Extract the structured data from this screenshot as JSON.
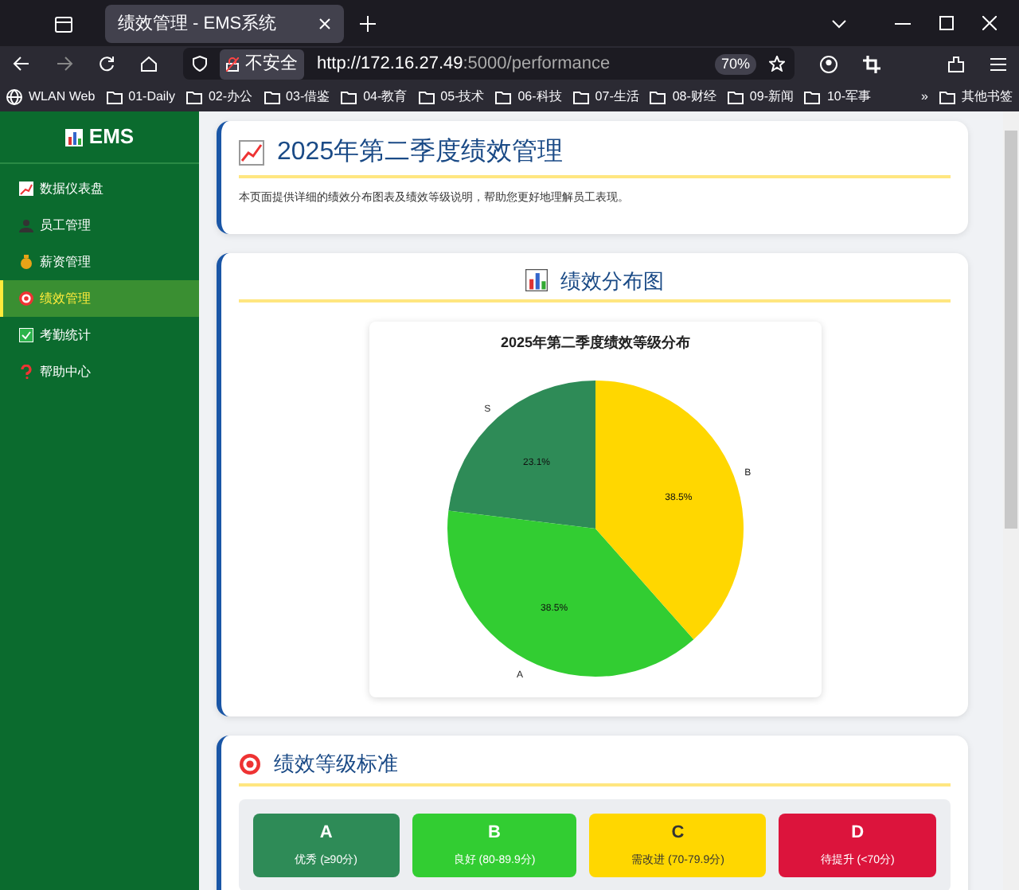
{
  "browser": {
    "tab_title": "绩效管理 - EMS系统",
    "security": "不安全",
    "url_host": "http://172.16.27.49",
    "url_rest": ":5000/performance",
    "zoom": "70%",
    "bookmarks": [
      {
        "label": "WLAN Web",
        "kind": "globe"
      },
      {
        "label": "01-Daily",
        "kind": "folder"
      },
      {
        "label": "02-办公",
        "kind": "folder"
      },
      {
        "label": "03-借鉴",
        "kind": "folder"
      },
      {
        "label": "04-教育",
        "kind": "folder"
      },
      {
        "label": "05-技术",
        "kind": "folder"
      },
      {
        "label": "06-科技",
        "kind": "folder"
      },
      {
        "label": "07-生活",
        "kind": "folder"
      },
      {
        "label": "08-财经",
        "kind": "folder"
      },
      {
        "label": "09-新闻",
        "kind": "folder"
      },
      {
        "label": "10-军事",
        "kind": "folder"
      }
    ],
    "overflow": "»",
    "other_bookmarks": "其他书签"
  },
  "sidebar": {
    "brand": "EMS",
    "items": [
      {
        "label": "数据仪表盘",
        "selected": false
      },
      {
        "label": "员工管理",
        "selected": false
      },
      {
        "label": "薪资管理",
        "selected": false
      },
      {
        "label": "绩效管理",
        "selected": true
      },
      {
        "label": "考勤统计",
        "selected": false
      },
      {
        "label": "帮助中心",
        "selected": false
      }
    ]
  },
  "header": {
    "title": "2025年第二季度绩效管理",
    "description": "本页面提供详细的绩效分布图表及绩效等级说明，帮助您更好地理解员工表现。"
  },
  "distribution": {
    "heading": "绩效分布图",
    "chart_data": {
      "type": "pie",
      "title": "2025年第二季度绩效等级分布",
      "categories": [
        "S",
        "A",
        "B"
      ],
      "values": [
        23.1,
        38.5,
        38.5
      ],
      "colors": [
        "#2e8b57",
        "#32cd32",
        "#ffd700"
      ],
      "value_labels": [
        "23.1%",
        "38.5%",
        "38.5%"
      ]
    }
  },
  "standards": {
    "heading": "绩效等级标准",
    "grades": [
      {
        "grade": "A",
        "desc": "优秀 (≥90分)",
        "color": "#2e8b57"
      },
      {
        "grade": "B",
        "desc": "良好 (80-89.9分)",
        "color": "#32cd32"
      },
      {
        "grade": "C",
        "desc": "需改进 (70-79.9分)",
        "color": "#ffd700"
      },
      {
        "grade": "D",
        "desc": "待提升 (<70分)",
        "color": "#dc143c"
      }
    ]
  }
}
